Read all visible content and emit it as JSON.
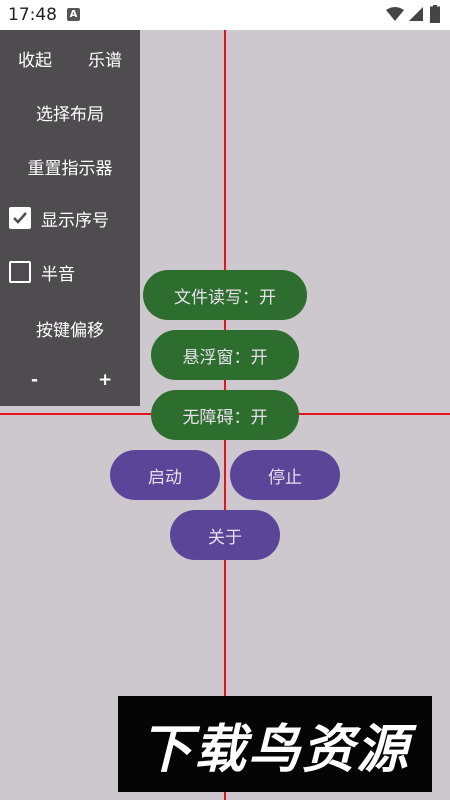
{
  "status_bar": {
    "time": "17:48",
    "notification_icon": "A",
    "icons": [
      "wifi-icon",
      "signal-icon",
      "battery-icon"
    ]
  },
  "side_panel": {
    "collapse_label": "收起",
    "sheet_label": "乐谱",
    "select_layout_label": "选择布局",
    "reset_indicator_label": "重置指示器",
    "show_sequence_label": "显示序号",
    "show_sequence_checked": true,
    "semitone_label": "半音",
    "semitone_checked": false,
    "key_offset_label": "按键偏移",
    "minus_label": "-",
    "plus_label": "+"
  },
  "buttons": {
    "file_rw": "文件读写：开",
    "floating_window": "悬浮窗：开",
    "accessibility": "无障碍：开",
    "start": "启动",
    "stop": "停止",
    "about": "关于"
  },
  "watermark": {
    "text": "下载鸟资源"
  },
  "colors": {
    "background": "#cdc8cd",
    "panel": "#4f4c50",
    "green_button": "#2d6d2e",
    "purple_button": "#5b4598",
    "crosshair": "#e0141b"
  }
}
